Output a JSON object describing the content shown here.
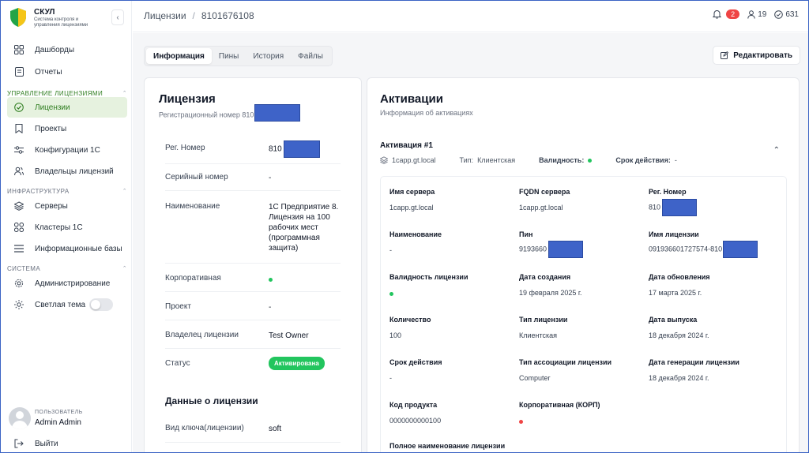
{
  "brand": {
    "name": "СКУЛ",
    "subtitle": "Система контроля и управления лицензиями",
    "colors": {
      "accent": "#2e7d1f",
      "shield_green": "#22a447",
      "shield_yellow": "#f5c518"
    }
  },
  "sidebar": {
    "top_items": [
      {
        "label": "Дашборды",
        "icon": "grid-icon"
      },
      {
        "label": "Отчеты",
        "icon": "document-icon"
      }
    ],
    "sections": [
      {
        "label": "УПРАВЛЕНИЕ ЛИЦЕНЗИЯМИ",
        "items": [
          {
            "label": "Лицензии",
            "icon": "check-circle-icon",
            "active": true
          },
          {
            "label": "Проекты",
            "icon": "bookmark-icon"
          },
          {
            "label": "Конфигурации 1С",
            "icon": "sliders-icon"
          },
          {
            "label": "Владельцы лицензий",
            "icon": "users-icon"
          }
        ]
      },
      {
        "label": "ИНФРАСТРУКТУРА",
        "items": [
          {
            "label": "Серверы",
            "icon": "layers-icon"
          },
          {
            "label": "Кластеры 1С",
            "icon": "cluster-icon"
          },
          {
            "label": "Информационные базы",
            "icon": "list-icon"
          }
        ]
      },
      {
        "label": "СИСТЕМА",
        "items": [
          {
            "label": "Администрирование",
            "icon": "gear-icon"
          },
          {
            "label": "Светлая тема",
            "icon": "sun-icon",
            "toggle": false
          }
        ]
      }
    ],
    "user": {
      "role": "ПОЛЬЗОВАТЕЛЬ",
      "name": "Admin Admin"
    },
    "logout": "Выйти"
  },
  "topbar": {
    "breadcrumb": [
      "Лицензии",
      "/",
      "8101676108"
    ],
    "notifications": "2",
    "users_count": "19",
    "check_count": "631"
  },
  "tabs": [
    "Информация",
    "Пины",
    "История",
    "Файлы"
  ],
  "edit_button": "Редактировать",
  "license": {
    "title": "Лицензия",
    "reg_subtitle": "Регистрационный номер 810",
    "rows": [
      {
        "k": "Рег. Номер",
        "v": "810"
      },
      {
        "k": "Серийный номер",
        "v": "-"
      },
      {
        "k": "Наименование",
        "v": "1С Предприятие 8. Лицензия на 100 рабочих мест (программная защита)"
      },
      {
        "k": "Корпоративная",
        "v": ""
      },
      {
        "k": "Проект",
        "v": "-"
      },
      {
        "k": "Владелец лицензии",
        "v": "Test Owner"
      },
      {
        "k": "Статус",
        "v": "Активирована"
      }
    ],
    "data_title": "Данные о лицензии",
    "data_rows": [
      {
        "k": "Вид ключа(лицензии)",
        "v": "soft"
      }
    ]
  },
  "activations": {
    "title": "Активации",
    "subtitle": "Информация об активациях",
    "item_title": "Активация #1",
    "host": "1capp.gt.local",
    "type_label": "Тип:",
    "type_value": "Клиентская",
    "validity_label": "Валидность:",
    "term_label": "Срок действия:",
    "term_value": "-",
    "fields": [
      {
        "k": "Имя сервера",
        "v": "1capp.gt.local"
      },
      {
        "k": "FQDN сервера",
        "v": "1capp.gt.local"
      },
      {
        "k": "Рег. Номер",
        "v": "810"
      },
      {
        "k": "Наименование",
        "v": "-"
      },
      {
        "k": "Пин",
        "v": "9193660"
      },
      {
        "k": "Имя лицензии",
        "v": "091936601727574-810"
      },
      {
        "k": "Валидность лицензии",
        "v": ""
      },
      {
        "k": "Дата создания",
        "v": "19 февраля 2025 г."
      },
      {
        "k": "Дата обновления",
        "v": "17 марта 2025 г."
      },
      {
        "k": "Количество",
        "v": "100"
      },
      {
        "k": "Тип лицензии",
        "v": "Клиентская"
      },
      {
        "k": "Дата выпуска",
        "v": "18 декабря 2024 г."
      },
      {
        "k": "Срок действия",
        "v": "-"
      },
      {
        "k": "Тип ассоциации лицензии",
        "v": "Computer"
      },
      {
        "k": "Дата генерации лицензии",
        "v": "18 декабря 2024 г."
      },
      {
        "k": "Код продукта",
        "v": "0000000000100"
      },
      {
        "k": "Корпоративная (КОРП)",
        "v": ""
      },
      {
        "k": "Полное наименование лицензии",
        "v": ""
      }
    ]
  }
}
